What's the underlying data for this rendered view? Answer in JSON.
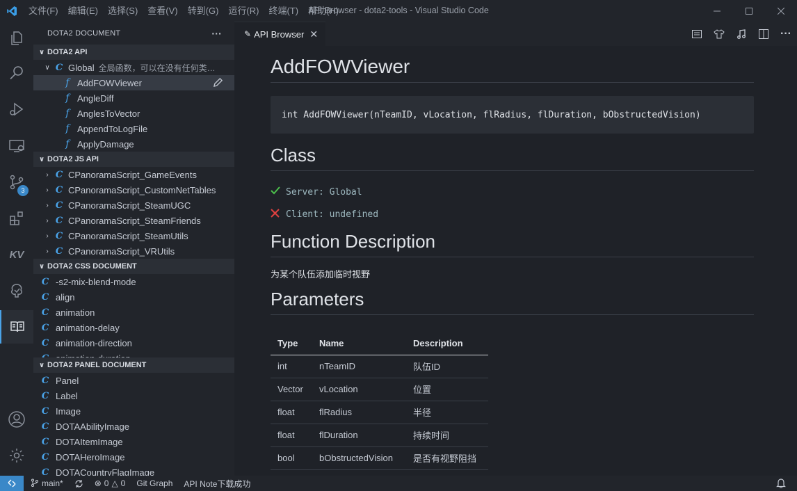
{
  "window": {
    "title": "API Browser - dota2-tools - Visual Studio Code",
    "menu": [
      "文件(F)",
      "编辑(E)",
      "选择(S)",
      "查看(V)",
      "转到(G)",
      "运行(R)",
      "终端(T)",
      "帮助(H)"
    ]
  },
  "activity": {
    "scm_badge": "3",
    "kv_label": "KV"
  },
  "sidebar": {
    "title": "DOTA2 DOCUMENT",
    "more": "···",
    "api_section": {
      "title": "DOTA2 API",
      "global_label": "Global",
      "global_desc": "全局函数，可以在没有任何类的...",
      "items": [
        "AddFOWViewer",
        "AngleDiff",
        "AnglesToVector",
        "AppendToLogFile",
        "ApplyDamage"
      ]
    },
    "js_section": {
      "title": "DOTA2 JS API",
      "items": [
        "CPanoramaScript_GameEvents",
        "CPanoramaScript_CustomNetTables",
        "CPanoramaScript_SteamUGC",
        "CPanoramaScript_SteamFriends",
        "CPanoramaScript_SteamUtils",
        "CPanoramaScript_VRUtils"
      ]
    },
    "css_section": {
      "title": "DOTA2 CSS DOCUMENT",
      "items": [
        "-s2-mix-blend-mode",
        "align",
        "animation",
        "animation-delay",
        "animation-direction",
        "animation-duration"
      ]
    },
    "panel_section": {
      "title": "DOTA2 PANEL DOCUMENT",
      "items": [
        "Panel",
        "Label",
        "Image",
        "DOTAAbilityImage",
        "DOTAItemImage",
        "DOTAHeroImage",
        "DOTACountryFlagImage"
      ]
    }
  },
  "editor": {
    "tab_label": "API Browser",
    "doc": {
      "title": "AddFOWViewer",
      "signature": "int AddFOWViewer(nTeamID, vLocation, flRadius, flDuration, bObstructedVision)",
      "class_heading": "Class",
      "server_line": "Server: Global",
      "client_line": "Client: undefined",
      "desc_heading": "Function Description",
      "description": "为某个队伍添加临时视野",
      "params_heading": "Parameters",
      "param_headers": [
        "Type",
        "Name",
        "Description"
      ],
      "params": [
        [
          "int",
          "nTeamID",
          "队伍ID"
        ],
        [
          "Vector",
          "vLocation",
          "位置"
        ],
        [
          "float",
          "flRadius",
          "半径"
        ],
        [
          "float",
          "flDuration",
          "持续时间"
        ],
        [
          "bool",
          "bObstructedVision",
          "是否有视野阻挡"
        ]
      ]
    }
  },
  "status": {
    "branch": "main*",
    "errors": "0",
    "warnings": "0",
    "git_graph": "Git Graph",
    "message": "API Note下载成功"
  },
  "colors": {
    "accent": "#4aa3e8",
    "background": "#1f2228",
    "sidebar": "#22252b"
  }
}
